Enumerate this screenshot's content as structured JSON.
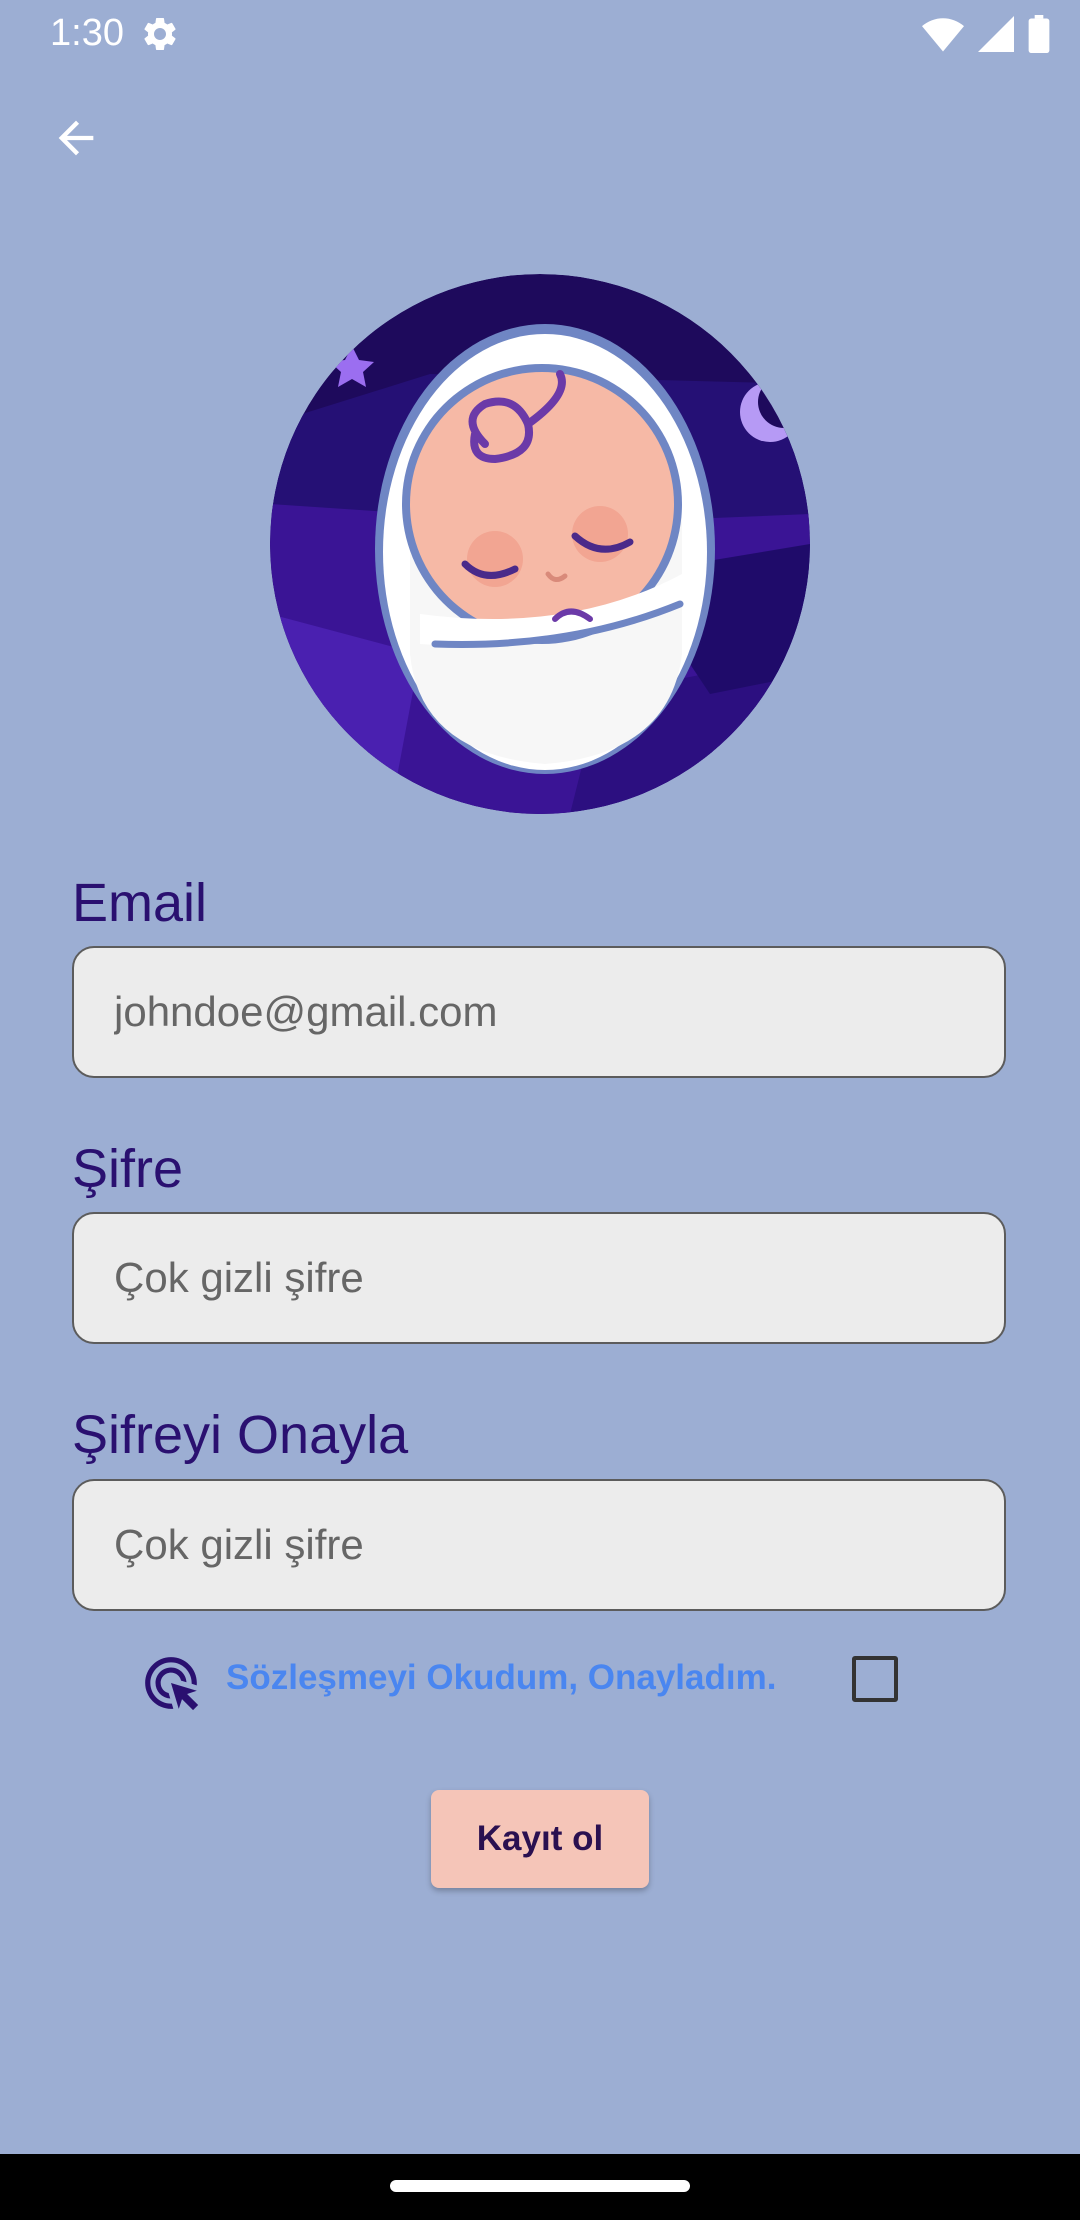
{
  "status_bar": {
    "time": "1:30",
    "icons": [
      "settings-icon",
      "wifi-icon",
      "signal-icon",
      "battery-icon"
    ]
  },
  "navigation": {
    "back_icon": "arrow-left-icon"
  },
  "form": {
    "email": {
      "label": "Email",
      "placeholder": "johndoe@gmail.com"
    },
    "password": {
      "label": "Şifre",
      "placeholder": "Çok gizli şifre"
    },
    "confirm_password": {
      "label": "Şifreyi Onayla",
      "placeholder": "Çok gizli şifre"
    },
    "agreement": {
      "text": "Sözleşmeyi Okudum, Onayladım.",
      "checked": false,
      "icon": "pointer-click-icon"
    },
    "submit_label": "Kayıt ol"
  },
  "colors": {
    "background": "#9caed3",
    "label": "#2a1070",
    "link": "#4a86f0",
    "button": "#f5c5b8"
  }
}
